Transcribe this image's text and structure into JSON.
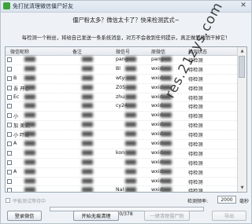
{
  "window": {
    "title": "免打扰清理微信僵尸好友",
    "close_glyph": "✕"
  },
  "header": {
    "headline": "僵尸粉太多？微信太卡了？快来检测武式~",
    "subline": "每检测一个粉丝，将给自己发送一条系统消息，对方不会收到任何提示，真正做到悄悄干掉它！"
  },
  "table": {
    "columns": [
      "微信昵称",
      "备注",
      "微信号",
      "原微信",
      "检测状态"
    ],
    "rows": [
      {
        "nick": "",
        "remark": "",
        "wxid": "pang",
        "orig": "pang",
        "status": "待检测"
      },
      {
        "nick": "",
        "remark": "",
        "wxid": "Bl",
        "orig": "wxid",
        "status": "待检测"
      },
      {
        "nick": "B",
        "remark": "",
        "wxid": "wty",
        "orig": "wxid",
        "status": "待检测"
      },
      {
        "nick": "吾  开心",
        "remark": "",
        "wxid": "Z05",
        "orig": "wxid",
        "status": "待检测"
      },
      {
        "nick": "Ec",
        "remark": "",
        "wxid": "zhu",
        "orig": "wxid",
        "status": "待检测"
      },
      {
        "nick": "",
        "remark": "",
        "wxid": "cy24",
        "orig": "wxid",
        "status": "待检测"
      },
      {
        "nick": "小",
        "remark": "",
        "wxid": "",
        "orig": "wxid",
        "status": "待检测"
      },
      {
        "nick": "加  美式",
        "remark": "",
        "wxid": "",
        "orig": "wxid",
        "status": "待检测"
      },
      {
        "nick": "小   吓醒",
        "remark": "",
        "wxid": "",
        "orig": "wxid",
        "status": "待检测"
      },
      {
        "nick": "A",
        "remark": "",
        "wxid": "",
        "orig": "wxid",
        "status": "待检测"
      },
      {
        "nick": "",
        "remark": "",
        "wxid": "kon",
        "orig": "wxid",
        "status": "待检测"
      },
      {
        "nick": "",
        "remark": "",
        "wxid": "",
        "orig": "wxid",
        "status": "待检测"
      },
      {
        "nick": "A",
        "remark": "",
        "wxid": "",
        "orig": "wxid",
        "status": "待检测"
      },
      {
        "nick": "",
        "remark": "",
        "wxid": "",
        "orig": "wxid",
        "status": "待检测"
      },
      {
        "nick": "",
        "remark": "",
        "wxid": "Nal",
        "orig": "wxid",
        "status": "待检测"
      },
      {
        "nick": "",
        "remark": "",
        "wxid": "",
        "orig": "wxid",
        "status": "待检测"
      }
    ]
  },
  "watermark": {
    "text": "res.21zys.com"
  },
  "status_bar": {
    "hint": "平板测试等待中",
    "freq_label": "检测频率:",
    "freq_value": "2000",
    "freq_unit": "毫秒"
  },
  "progress": {
    "current": 0,
    "total": 378,
    "label": "0/378"
  },
  "buttons": {
    "login": "登录微信",
    "start": "开始无痕清理",
    "delete_all": "一键清理僵尸粉",
    "export": "导出"
  },
  "colors": {
    "accent": "#5b9be0",
    "app_icon": "#3da23a"
  }
}
